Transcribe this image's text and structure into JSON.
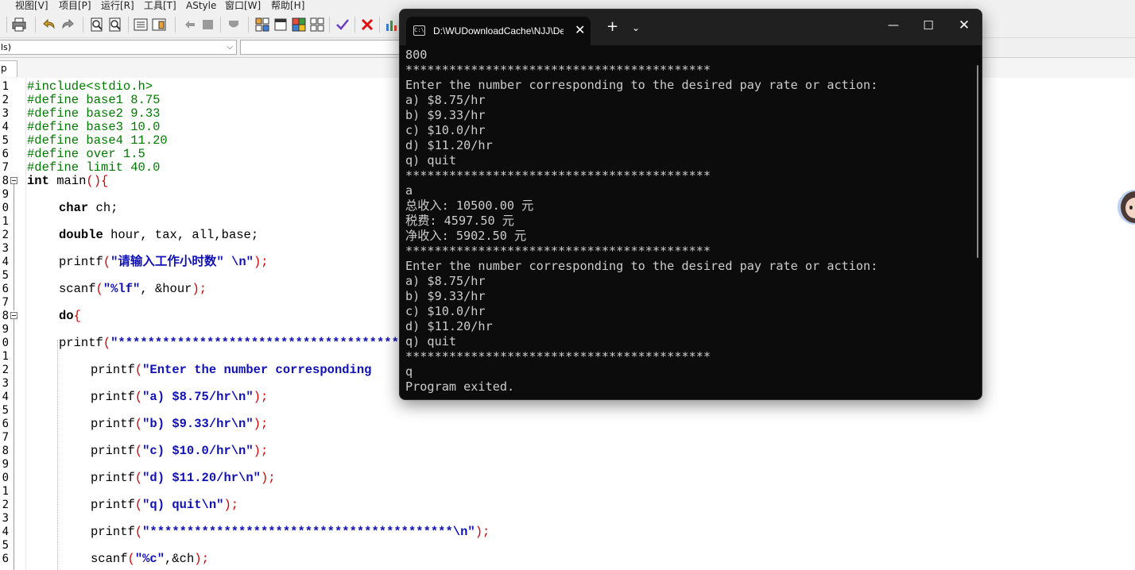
{
  "ide": {
    "menu": [
      "视图[V]",
      "项目[P]",
      "运行[R]",
      "工具[T]",
      "AStyle",
      "窗口[W]",
      "帮助[H]"
    ],
    "scope_combo": "ls)",
    "project_tab": "p",
    "line_numbers": [
      "1",
      "2",
      "3",
      "4",
      "5",
      "6",
      "7",
      "8",
      "9",
      "0",
      "1",
      "2",
      "3",
      "4",
      "5",
      "6",
      "7",
      "8",
      "9",
      "0",
      "1",
      "2",
      "3",
      "4",
      "5",
      "6",
      "7",
      "8",
      "9",
      "0",
      "1",
      "2",
      "3",
      "4",
      "5",
      "6"
    ],
    "code": {
      "l1": "#include<stdio.h>",
      "l2": "#define base1 8.75",
      "l3": "#define base2 9.33",
      "l4": "#define base3 10.0",
      "l5": "#define base4 11.20",
      "l6": "#define over 1.5",
      "l7": "#define limit 40.0",
      "main_kw": "int",
      "main_name": " main",
      "main_paren": "(){",
      "ch_kw": "char",
      "ch_rest": " ch;",
      "dbl_kw": "double",
      "dbl_rest": " hour, tax, all,base;",
      "p1_fn": "printf",
      "p1_open": "(",
      "p1_str": "\"请输入工作小时数\" \\n\"",
      "p1_close": ");",
      "scanf1_fn": "scanf",
      "scanf1_open": "(",
      "scanf1_str": "\"%lf\"",
      "scanf1_rest": ", &hour",
      "scanf1_close": ");",
      "do_kw": "do",
      "do_brace": "{",
      "p2_fn": "printf",
      "p2_open": "(",
      "p2_str": "\"**************************************",
      "p3_fn": "printf",
      "p3_open": "(",
      "p3_str": "\"Enter the number corresponding",
      "p4_fn": "printf",
      "p4_open": "(",
      "p4_str": "\"a) $8.75/hr\\n\"",
      "p4_close": ");",
      "p5_fn": "printf",
      "p5_open": "(",
      "p5_str": "\"b) $9.33/hr\\n\"",
      "p5_close": ");",
      "p6_fn": "printf",
      "p6_open": "(",
      "p6_str": "\"c) $10.0/hr\\n\"",
      "p6_close": ");",
      "p7_fn": "printf",
      "p7_open": "(",
      "p7_str": "\"d) $11.20/hr\\n\"",
      "p7_close": ");",
      "p8_fn": "printf",
      "p8_open": "(",
      "p8_str": "\"q) quit\\n\"",
      "p8_close": ");",
      "p9_fn": "printf",
      "p9_open": "(",
      "p9_str": "\"*****************************************\\n\"",
      "p9_close": ");",
      "scanf2_fn": "scanf",
      "scanf2_open": "(",
      "scanf2_str": "\"%c\"",
      "scanf2_rest": ",&ch",
      "scanf2_close": ");"
    }
  },
  "terminal": {
    "tab_title": "D:\\WUDownloadCache\\NJJ\\De",
    "tab_icon": "C:\\",
    "close_tab": "✕",
    "new_tab": "+",
    "dropdown": "⌄",
    "minimize": "—",
    "maximize": "☐",
    "close": "✕",
    "lines": [
      "800",
      "******************************************",
      "Enter the number corresponding to the desired pay rate or action:",
      "a) $8.75/hr",
      "b) $9.33/hr",
      "c) $10.0/hr",
      "d) $11.20/hr",
      "q) quit",
      "******************************************",
      "a",
      "总收入: 10500.00 元",
      "税费: 4597.50 元",
      "净收入: 5902.50 元",
      "******************************************",
      "Enter the number corresponding to the desired pay rate or action:",
      "a) $8.75/hr",
      "b) $9.33/hr",
      "c) $10.0/hr",
      "d) $11.20/hr",
      "q) quit",
      "******************************************",
      "q",
      "Program exited."
    ]
  }
}
